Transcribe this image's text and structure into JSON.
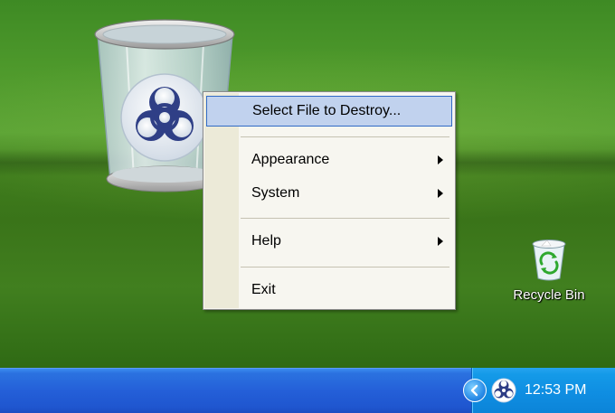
{
  "menu": {
    "items": [
      {
        "label": "Select File to Destroy...",
        "has_submenu": false,
        "selected": true
      },
      {
        "label": "Appearance",
        "has_submenu": true,
        "selected": false
      },
      {
        "label": "System",
        "has_submenu": true,
        "selected": false
      },
      {
        "label": "Help",
        "has_submenu": true,
        "selected": false
      },
      {
        "label": "Exit",
        "has_submenu": false,
        "selected": false
      }
    ]
  },
  "desktop": {
    "recycle_bin_label": "Recycle Bin",
    "widget_icon": "biohazard-trash-can-icon"
  },
  "taskbar": {
    "clock": "12:53 PM",
    "tray_icons": [
      "show-hidden-icons-chevron-icon",
      "biohazard-tray-icon"
    ]
  },
  "colors": {
    "taskbar_blue": "#245fd8",
    "tray_blue": "#0f8ee2",
    "menu_background": "#f7f6f0",
    "menu_selection": "#c1d2ee",
    "menu_selection_border": "#316ac5"
  }
}
